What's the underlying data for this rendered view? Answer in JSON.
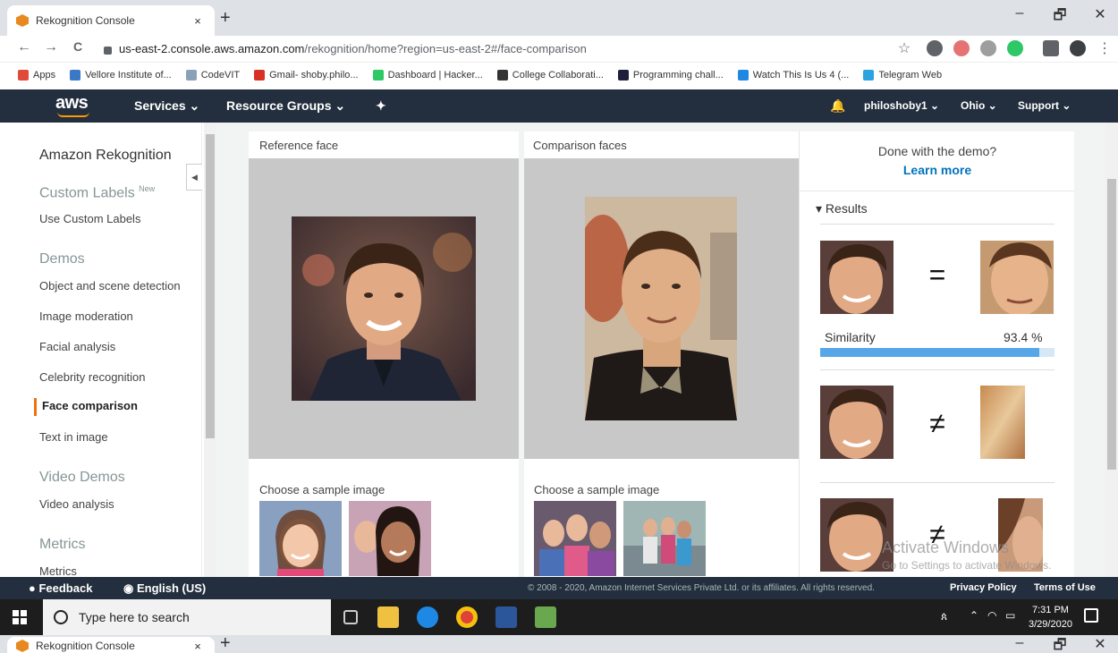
{
  "browser": {
    "tab_title": "Rekognition Console",
    "tab_close": "×",
    "new_tab": "+",
    "url_host": "us-east-2.console.aws.amazon.com",
    "url_path": "/rekognition/home?region=us-east-2#/face-comparison",
    "win_min": "–",
    "win_max": "🗗",
    "win_close": "✕",
    "back": "←",
    "forward": "→",
    "reload": "C",
    "star": "☆",
    "menu": "⋮"
  },
  "bookmarks": [
    {
      "label": "Apps",
      "color": "#e04a3a"
    },
    {
      "label": "Vellore Institute of...",
      "color": "#3b78c6"
    },
    {
      "label": "CodeVIT",
      "color": "#8aa1b8"
    },
    {
      "label": "Gmail- shoby.philo...",
      "color": "#d93025"
    },
    {
      "label": "Dashboard | Hacker...",
      "color": "#2ec866"
    },
    {
      "label": "College Collaborati...",
      "color": "#333333"
    },
    {
      "label": "Programming chall...",
      "color": "#1f1f3c"
    },
    {
      "label": "Watch This Is Us 4 (...",
      "color": "#1e88e5"
    },
    {
      "label": "Telegram Web",
      "color": "#2aa3df"
    }
  ],
  "aws_nav": {
    "logo": "aws",
    "services": "Services ⌄",
    "resource_groups": "Resource Groups ⌄",
    "pin": "✦",
    "bell": "🔔",
    "user": "philoshoby1 ⌄",
    "region": "Ohio ⌄",
    "support": "Support ⌄"
  },
  "sidebar": {
    "title": "Amazon Rekognition",
    "custom_labels": "Custom Labels",
    "new_badge": "New",
    "use_custom_labels": "Use Custom Labels",
    "demos": "Demos",
    "items": [
      "Object and scene detection",
      "Image moderation",
      "Facial analysis",
      "Celebrity recognition",
      "Face comparison",
      "Text in image"
    ],
    "video_demos": "Video Demos",
    "video_analysis": "Video analysis",
    "metrics_section": "Metrics",
    "metrics_link": "Metrics",
    "collapse": "◀"
  },
  "main": {
    "reference_label": "Reference face",
    "comparison_label": "Comparison faces",
    "choose_sample_left": "Choose a sample image",
    "choose_sample_right": "Choose a sample image"
  },
  "results": {
    "done_text": "Done with the demo?",
    "learn_more": "Learn more",
    "heading": "▾ Results",
    "match_op": "=",
    "nomatch_op": "≠",
    "similarity_label": "Similarity",
    "similarity_value": "93.4 %",
    "similarity_fraction": 0.934,
    "watermark_title": "Activate Windows",
    "watermark_sub": "Go to Settings to activate Windows."
  },
  "footer": {
    "feedback": "Feedback",
    "language": "English (US)",
    "copyright": "© 2008 - 2020, Amazon Internet Services Private Ltd. or its affiliates. All rights reserved.",
    "privacy": "Privacy Policy",
    "terms": "Terms of Use"
  },
  "taskbar": {
    "search_placeholder": "Type here to search",
    "time": "7:31 PM",
    "date": "3/29/2020"
  }
}
